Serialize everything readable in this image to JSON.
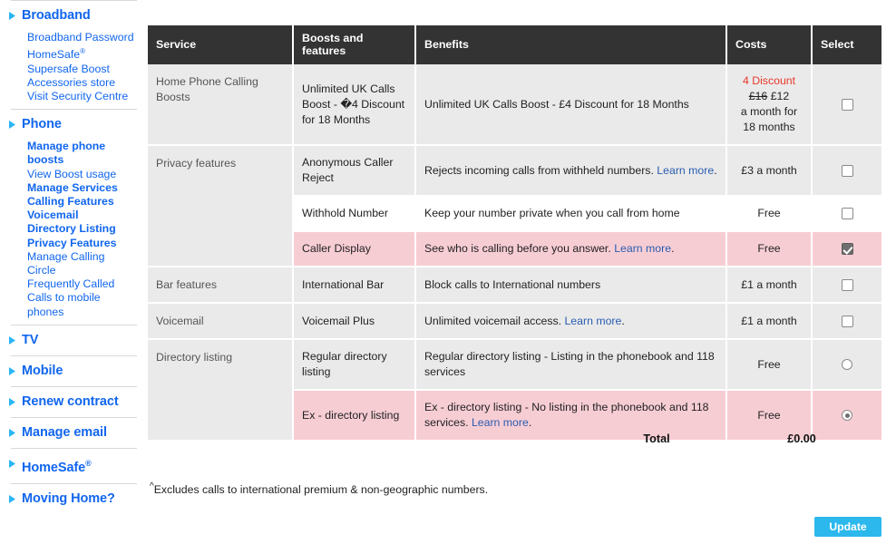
{
  "sidebar": {
    "groups": [
      {
        "label": "Broadband",
        "icon": "chevron-right-icon",
        "items": [
          {
            "label": "Broadband Password",
            "bold": false
          },
          {
            "label": "HomeSafe",
            "sup": "®",
            "bold": false
          },
          {
            "label": "Supersafe Boost",
            "bold": false
          },
          {
            "label": "Accessories store",
            "bold": false
          },
          {
            "label": "Visit Security Centre",
            "bold": false
          }
        ]
      },
      {
        "label": "Phone",
        "icon": "chevron-right-icon",
        "items": [
          {
            "label": "Manage phone boosts",
            "bold": true
          },
          {
            "label": "View Boost usage",
            "bold": false
          },
          {
            "label": "Manage Services",
            "bold": true
          },
          {
            "label": "Calling Features",
            "bold": true
          },
          {
            "label": "Voicemail",
            "bold": true
          },
          {
            "label": "Directory Listing",
            "bold": true
          },
          {
            "label": "Privacy Features",
            "bold": true
          },
          {
            "label": "Manage Calling Circle",
            "bold": false
          },
          {
            "label": "Frequently Called",
            "bold": false
          },
          {
            "label": "Calls to mobile phones",
            "bold": false
          }
        ]
      },
      {
        "label": "TV",
        "icon": "chevron-right-icon",
        "items": []
      },
      {
        "label": "Mobile",
        "icon": "chevron-right-icon",
        "items": []
      },
      {
        "label": "Renew contract",
        "icon": "chevron-right-icon",
        "items": []
      },
      {
        "label": "Manage email",
        "icon": "chevron-right-icon",
        "items": []
      },
      {
        "label": "HomeSafe",
        "sup": "®",
        "icon": "chevron-right-icon",
        "items": []
      },
      {
        "label": "Moving Home?",
        "icon": "chevron-right-icon",
        "items": []
      }
    ]
  },
  "table": {
    "headers": [
      "Service",
      "Boosts and features",
      "Benefits",
      "Costs",
      "Select"
    ],
    "rows": [
      {
        "group": "Home Phone Calling Boosts",
        "group_rowspan": 1,
        "feature": "Unlimited UK Calls Boost - �4 Discount for 18 Months",
        "benefit": "Unlimited UK Calls Boost - £4 Discount for 18 Months",
        "benefit_link": "",
        "cost_lines": [
          "4 Discount",
          "£16 £12",
          "a month for",
          "18 months"
        ],
        "cost_discount": "4 Discount",
        "cost_was": "£16",
        "cost_now": "£12",
        "cost_line3": "a month for",
        "cost_line4": "18 months",
        "control": "checkbox",
        "checked": false,
        "highlight": "grey"
      },
      {
        "group": "Privacy features",
        "group_rowspan": 3,
        "feature": "Anonymous Caller Reject",
        "benefit": "Rejects incoming calls from withheld numbers.",
        "benefit_link": "Learn more",
        "cost": "£3 a month",
        "control": "checkbox",
        "checked": false,
        "highlight": "grey"
      },
      {
        "group": "",
        "feature": "Withhold Number",
        "benefit": "Keep your number private when you call from home",
        "benefit_link": "",
        "cost": "Free",
        "control": "checkbox",
        "checked": false,
        "highlight": "white"
      },
      {
        "group": "",
        "feature": "Caller Display",
        "benefit": "See who is calling before you answer.",
        "benefit_link": "Learn more",
        "cost": "Free",
        "control": "checkbox",
        "checked": true,
        "highlight": "pink"
      },
      {
        "group": "Bar features",
        "group_rowspan": 1,
        "feature": "International Bar",
        "benefit": "Block calls to International numbers",
        "benefit_link": "",
        "cost": "£1 a month",
        "control": "checkbox",
        "checked": false,
        "highlight": "grey"
      },
      {
        "group": "Voicemail",
        "group_rowspan": 1,
        "feature": "Voicemail Plus",
        "benefit": "Unlimited voicemail access.",
        "benefit_link": "Learn more",
        "cost": "£1 a month",
        "control": "checkbox",
        "checked": false,
        "highlight": "grey"
      },
      {
        "group": "Directory listing",
        "group_rowspan": 2,
        "feature": "Regular directory listing",
        "benefit": "Regular directory listing - Listing in the phonebook and 118 services",
        "benefit_link": "",
        "cost": "Free",
        "control": "radio",
        "checked": false,
        "highlight": "grey"
      },
      {
        "group": "",
        "feature": "Ex - directory listing",
        "benefit": "Ex - directory listing - No listing in the phonebook and 118 services.",
        "benefit_link": "Learn more",
        "cost": "Free",
        "control": "radio",
        "checked": true,
        "highlight": "pink"
      }
    ]
  },
  "total": {
    "label": "Total",
    "value": "£0.00"
  },
  "footnote": {
    "marker": "^",
    "text": "Excludes calls to international premium & non-geographic numbers."
  },
  "update_button": {
    "label": "Update"
  },
  "colors": {
    "header_bg": "#333333",
    "row_grey": "#eaeaea",
    "row_pink": "#f7cdd4",
    "link": "#2a5db0",
    "nav_link": "#1166ee",
    "nav_arrow": "#29b6f6",
    "discount_red": "#e8372a",
    "button_blue": "#2cb8ec"
  }
}
